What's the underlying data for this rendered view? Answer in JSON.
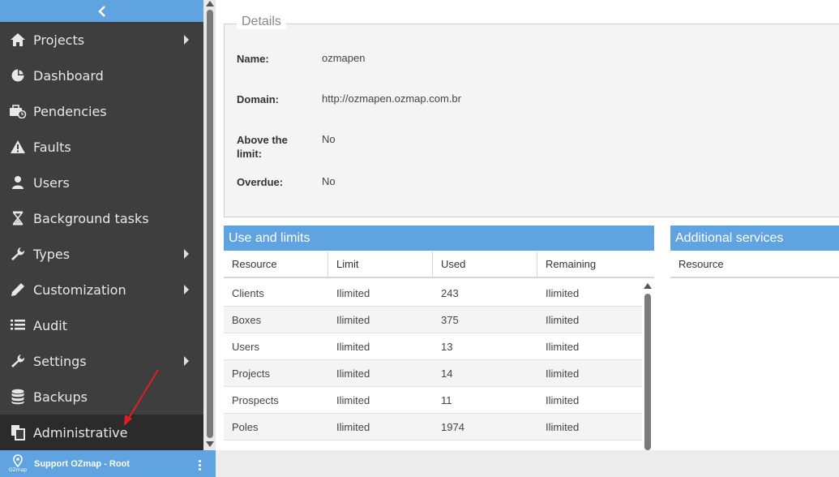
{
  "sidebar": {
    "collapse_icon": "chevron-left-icon",
    "items": [
      {
        "label": "Projects",
        "icon": "home-icon",
        "submenu": true
      },
      {
        "label": "Dashboard",
        "icon": "pie-chart-icon",
        "submenu": false
      },
      {
        "label": "Pendencies",
        "icon": "briefcase-clock-icon",
        "submenu": false
      },
      {
        "label": "Faults",
        "icon": "warning-icon",
        "submenu": false
      },
      {
        "label": "Users",
        "icon": "user-icon",
        "submenu": false
      },
      {
        "label": "Background tasks",
        "icon": "hourglass-icon",
        "submenu": false
      },
      {
        "label": "Types",
        "icon": "wrench-icon",
        "submenu": true
      },
      {
        "label": "Customization",
        "icon": "pencil-icon",
        "submenu": true
      },
      {
        "label": "Audit",
        "icon": "list-icon",
        "submenu": false
      },
      {
        "label": "Settings",
        "icon": "wrench-icon",
        "submenu": true
      },
      {
        "label": "Backups",
        "icon": "database-icon",
        "submenu": false
      },
      {
        "label": "Administrative",
        "icon": "copy-icon",
        "submenu": false,
        "active": true
      }
    ]
  },
  "footer": {
    "user_name": "Support OZmap - Root",
    "logo_text": "OZmap",
    "menu_icon": "vertical-dots-icon"
  },
  "details": {
    "legend": "Details",
    "fields": [
      {
        "label": "Name:",
        "value": "ozmapen"
      },
      {
        "label": "Domain:",
        "value": "http://ozmapen.ozmap.com.br"
      },
      {
        "label": "Above the limit:",
        "value": "No"
      },
      {
        "label": "Overdue:",
        "value": "No"
      }
    ]
  },
  "use_limits": {
    "title": "Use and limits",
    "columns": [
      "Resource",
      "Limit",
      "Used",
      "Remaining"
    ],
    "rows": [
      [
        "Clients",
        "Ilimited",
        "243",
        "Ilimited"
      ],
      [
        "Boxes",
        "Ilimited",
        "375",
        "Ilimited"
      ],
      [
        "Users",
        "Ilimited",
        "13",
        "Ilimited"
      ],
      [
        "Projects",
        "Ilimited",
        "14",
        "Ilimited"
      ],
      [
        "Prospects",
        "Ilimited",
        "11",
        "Ilimited"
      ],
      [
        "Poles",
        "Ilimited",
        "1974",
        "Ilimited"
      ]
    ]
  },
  "additional_services": {
    "title": "Additional services",
    "columns": [
      "Resource"
    ]
  },
  "colors": {
    "accent": "#5fa3e0",
    "sidebar_bg": "#3e3e3e",
    "annotation": "#e02020"
  }
}
